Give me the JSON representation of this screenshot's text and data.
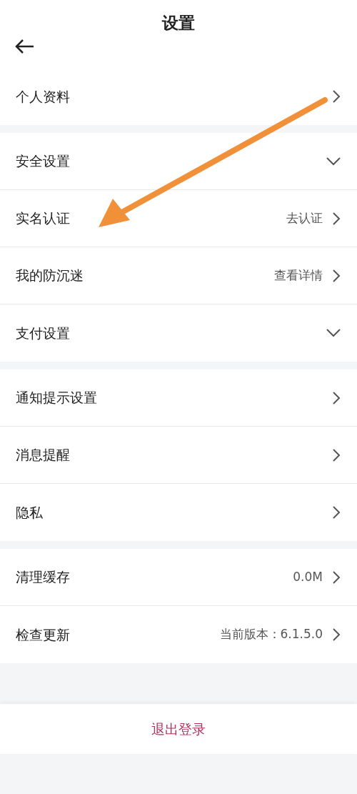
{
  "header": {
    "title": "设置"
  },
  "groups": [
    {
      "items": [
        {
          "label": "个人资料",
          "kind": "link"
        }
      ]
    },
    {
      "items": [
        {
          "label": "安全设置",
          "kind": "dropdown"
        },
        {
          "label": "实名认证",
          "value": "去认证",
          "kind": "link"
        },
        {
          "label": "我的防沉迷",
          "value": "查看详情",
          "kind": "link"
        },
        {
          "label": "支付设置",
          "kind": "dropdown"
        }
      ]
    },
    {
      "items": [
        {
          "label": "通知提示设置",
          "kind": "link"
        },
        {
          "label": "消息提醒",
          "kind": "link"
        },
        {
          "label": "隐私",
          "kind": "link"
        }
      ]
    },
    {
      "items": [
        {
          "label": "清理缓存",
          "value": "0.0M",
          "kind": "link"
        },
        {
          "label": "检查更新",
          "value": "当前版本：6.1.5.0",
          "kind": "link"
        }
      ]
    }
  ],
  "logout": {
    "label": "退出登录"
  }
}
